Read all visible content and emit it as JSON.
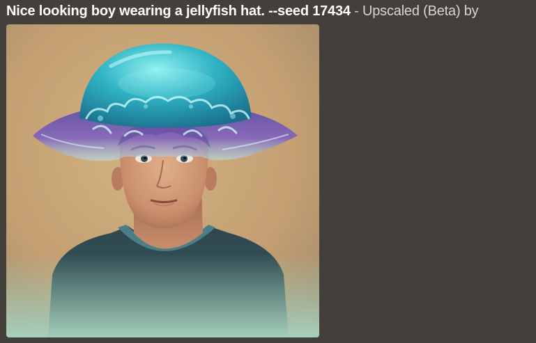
{
  "message": {
    "prompt_text": "Nice looking boy wearing a jellyfish hat. --seed 17434",
    "separator": " - ",
    "status_text": "Upscaled (Beta) by"
  },
  "attachment": {
    "kind": "generated-image",
    "subject": "portrait of a boy wearing a translucent turquoise jellyfish hat"
  },
  "colors": {
    "background": "#433f3a",
    "prompt": "#ffffff",
    "status": "#d8d4ce",
    "image_background": "#c9a575",
    "hat": "#2fb3c4",
    "shirt": "#2f4a52"
  }
}
